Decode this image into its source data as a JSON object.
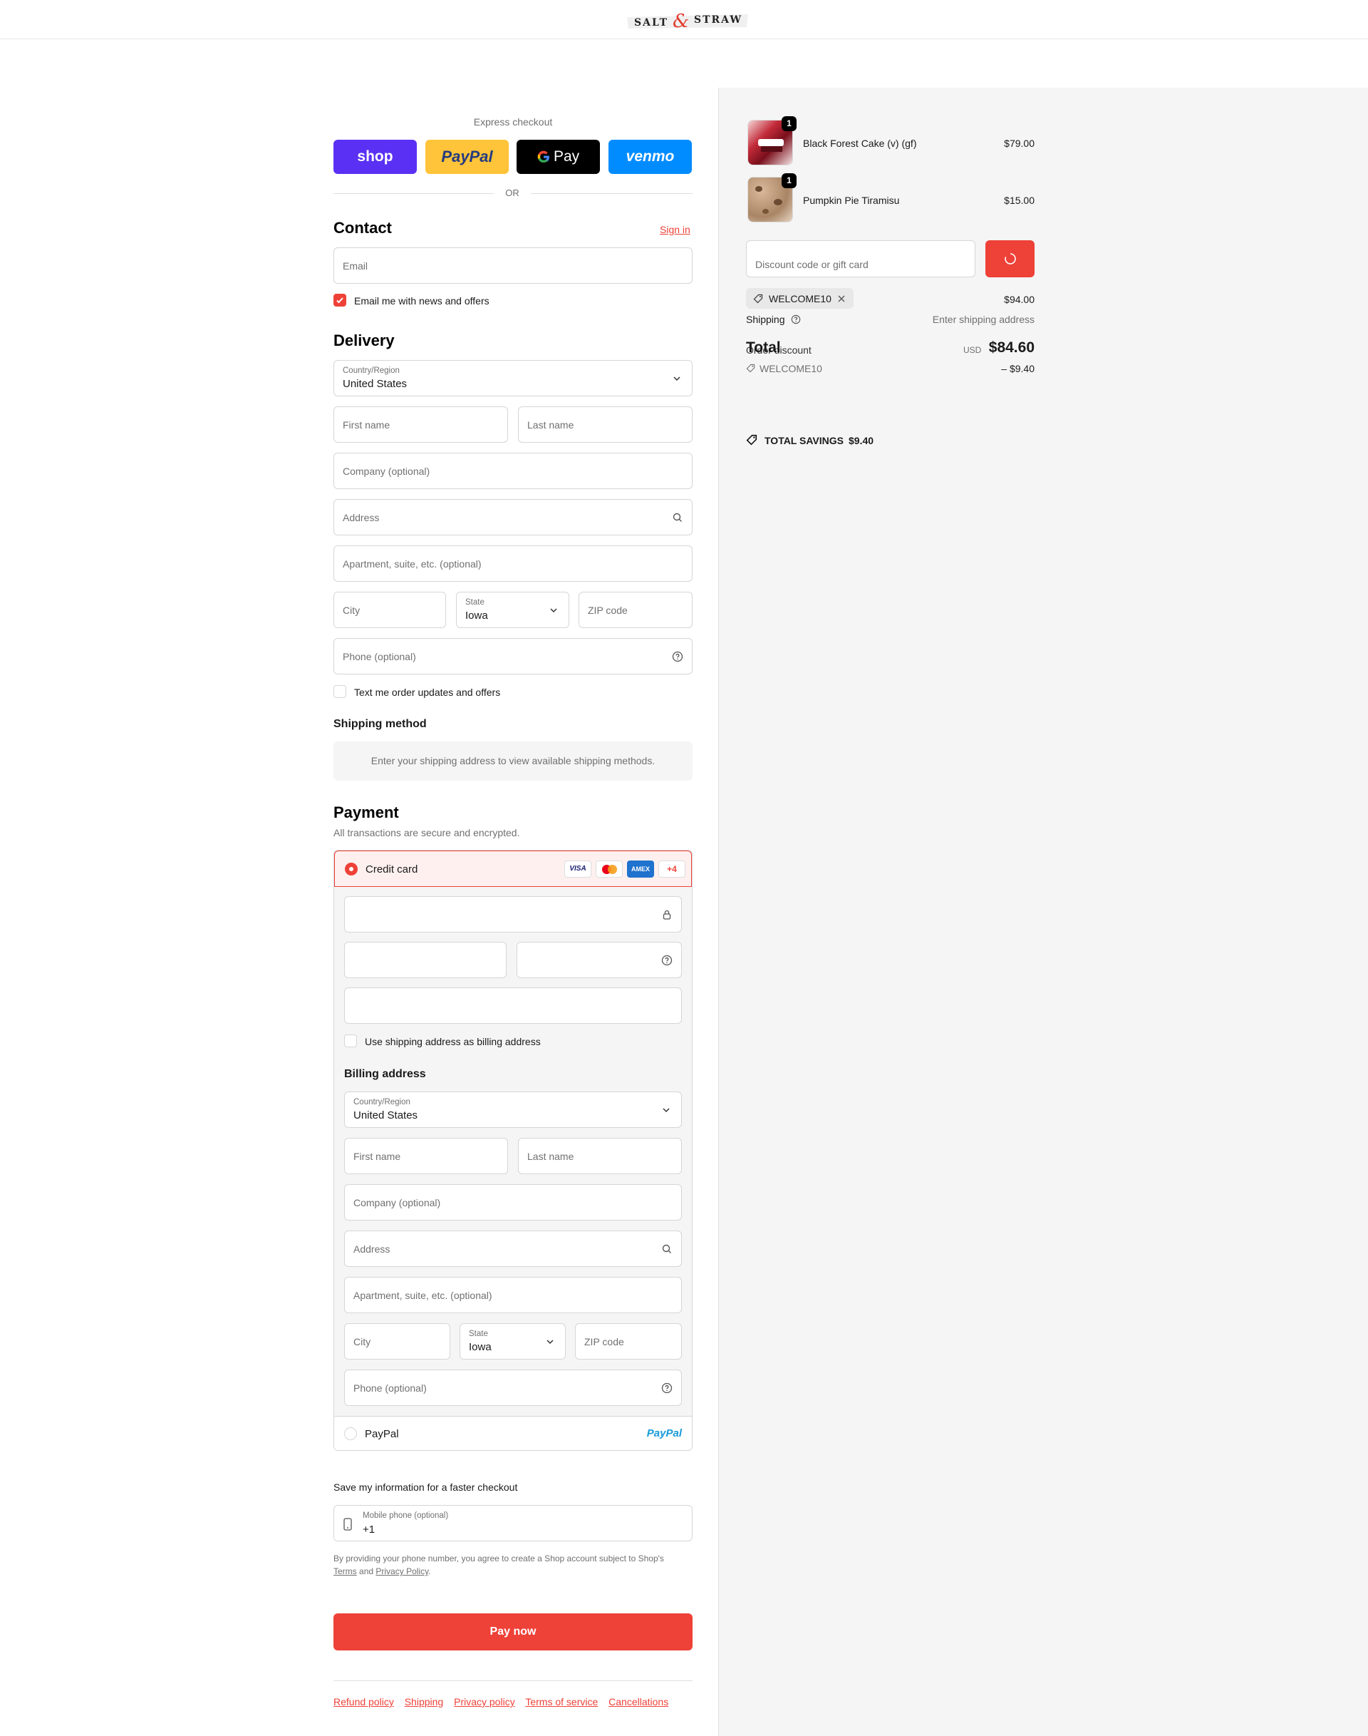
{
  "header": {
    "logo_text": "SALT & STRAW"
  },
  "express": {
    "title": "Express checkout",
    "shop": "shop",
    "paypal": "PayPal",
    "gpay": "Pay",
    "venmo": "venmo",
    "or": "OR"
  },
  "contact": {
    "title": "Contact",
    "sign_in": "Sign in",
    "email_placeholder": "Email",
    "news_label": "Email me with news and offers"
  },
  "delivery": {
    "title": "Delivery",
    "country_label": "Country/Region",
    "country_value": "United States",
    "first_name": "First name",
    "last_name": "Last name",
    "company": "Company (optional)",
    "address": "Address",
    "apartment": "Apartment, suite, etc. (optional)",
    "city": "City",
    "state_label": "State",
    "state_value": "Iowa",
    "zip": "ZIP code",
    "phone": "Phone (optional)",
    "sms_label": "Text me order updates and offers"
  },
  "shipping_method": {
    "title": "Shipping method",
    "message": "Enter your shipping address to view available shipping methods."
  },
  "payment": {
    "title": "Payment",
    "subtitle": "All transactions are secure and encrypted.",
    "credit_card_label": "Credit card",
    "visa": "VISA",
    "amex": "AMEX",
    "more_cards": "+4",
    "use_shipping_label": "Use shipping address as billing address",
    "billing_title": "Billing address",
    "paypal_label": "PayPal",
    "paypal_logo": "PayPal"
  },
  "billing": {
    "country_label": "Country/Region",
    "country_value": "United States",
    "first_name": "First name",
    "last_name": "Last name",
    "company": "Company (optional)",
    "address": "Address",
    "apartment": "Apartment, suite, etc. (optional)",
    "city": "City",
    "state_label": "State",
    "state_value": "Iowa",
    "zip": "ZIP code",
    "phone": "Phone (optional)"
  },
  "save_info": {
    "title": "Save my information for a faster checkout",
    "mobile_label": "Mobile phone (optional)",
    "mobile_value": "+1",
    "legal_prefix": "By providing your phone number, you agree to create a Shop account subject to Shop's",
    "terms": "Terms",
    "and": "and",
    "privacy": "Privacy Policy",
    "period": "."
  },
  "pay_now": "Pay now",
  "footer_links": [
    "Refund policy",
    "Shipping",
    "Privacy policy",
    "Terms of service",
    "Cancellations"
  ],
  "cart": {
    "items": [
      {
        "name": "Black Forest Cake (v) (gf)",
        "price": "$79.00",
        "qty": "1"
      },
      {
        "name": "Pumpkin Pie Tiramisu",
        "price": "$15.00",
        "qty": "1"
      }
    ],
    "discount_placeholder": "Discount code or gift card",
    "applied_code": "WELCOME10",
    "subtotal_value": "$94.00",
    "shipping_label": "Shipping",
    "shipping_value": "Enter shipping address",
    "total_label": "Total",
    "order_discount_label": "Order discount",
    "currency": "USD",
    "total_value": "$84.60",
    "discount_code": "WELCOME10",
    "discount_value": "– $9.40",
    "savings_label": "TOTAL SAVINGS",
    "savings_value": "$9.40"
  },
  "colors": {
    "accent": "#ee4138",
    "shop": "#5a31f4",
    "paypal_yellow": "#ffc439",
    "venmo": "#008cff"
  }
}
